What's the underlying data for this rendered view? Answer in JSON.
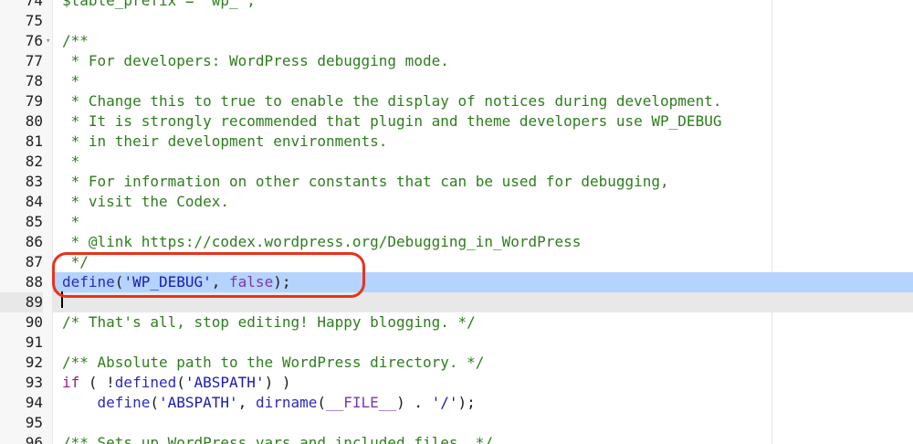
{
  "editor": {
    "lines": [
      {
        "num": "74",
        "fold": "",
        "hl": "",
        "tokens": [
          {
            "c": "comment",
            "t": "$table_prefix = 'wp_';"
          }
        ]
      },
      {
        "num": "75",
        "fold": "",
        "hl": "",
        "tokens": []
      },
      {
        "num": "76",
        "fold": "▾",
        "hl": "",
        "tokens": [
          {
            "c": "comment",
            "t": "/**"
          }
        ]
      },
      {
        "num": "77",
        "fold": "",
        "hl": "",
        "tokens": [
          {
            "c": "comment",
            "t": " * For developers: WordPress debugging mode."
          }
        ]
      },
      {
        "num": "78",
        "fold": "",
        "hl": "",
        "tokens": [
          {
            "c": "comment",
            "t": " *"
          }
        ]
      },
      {
        "num": "79",
        "fold": "",
        "hl": "",
        "tokens": [
          {
            "c": "comment",
            "t": " * Change this to true to enable the display of notices during development."
          }
        ]
      },
      {
        "num": "80",
        "fold": "",
        "hl": "",
        "tokens": [
          {
            "c": "comment",
            "t": " * It is strongly recommended that plugin and theme developers use WP_DEBUG"
          }
        ]
      },
      {
        "num": "81",
        "fold": "",
        "hl": "",
        "tokens": [
          {
            "c": "comment",
            "t": " * in their development environments."
          }
        ]
      },
      {
        "num": "82",
        "fold": "",
        "hl": "",
        "tokens": [
          {
            "c": "comment",
            "t": " *"
          }
        ]
      },
      {
        "num": "83",
        "fold": "",
        "hl": "",
        "tokens": [
          {
            "c": "comment",
            "t": " * For information on other constants that can be used for debugging,"
          }
        ]
      },
      {
        "num": "84",
        "fold": "",
        "hl": "",
        "tokens": [
          {
            "c": "comment",
            "t": " * visit the Codex."
          }
        ]
      },
      {
        "num": "85",
        "fold": "",
        "hl": "",
        "tokens": [
          {
            "c": "comment",
            "t": " *"
          }
        ]
      },
      {
        "num": "86",
        "fold": "",
        "hl": "",
        "tokens": [
          {
            "c": "comment",
            "t": " * @link https://codex.wordpress.org/Debugging_in_WordPress"
          }
        ]
      },
      {
        "num": "87",
        "fold": "",
        "hl": "",
        "tokens": [
          {
            "c": "comment",
            "t": " */"
          }
        ]
      },
      {
        "num": "88",
        "fold": "",
        "hl": "sel",
        "tokens": [
          {
            "c": "func",
            "t": "define"
          },
          {
            "c": "plain",
            "t": "("
          },
          {
            "c": "str",
            "t": "'WP_DEBUG'"
          },
          {
            "c": "plain",
            "t": ", "
          },
          {
            "c": "const",
            "t": "false"
          },
          {
            "c": "plain",
            "t": ");"
          }
        ]
      },
      {
        "num": "89",
        "fold": "",
        "hl": "cur",
        "tokens": []
      },
      {
        "num": "90",
        "fold": "",
        "hl": "",
        "tokens": [
          {
            "c": "comment",
            "t": "/* That's all, stop editing! Happy blogging. */"
          }
        ]
      },
      {
        "num": "91",
        "fold": "",
        "hl": "",
        "tokens": []
      },
      {
        "num": "92",
        "fold": "",
        "hl": "",
        "tokens": [
          {
            "c": "comment",
            "t": "/** Absolute path to the WordPress directory. */"
          }
        ]
      },
      {
        "num": "93",
        "fold": "",
        "hl": "",
        "tokens": [
          {
            "c": "key",
            "t": "if"
          },
          {
            "c": "plain",
            "t": " ( !"
          },
          {
            "c": "func",
            "t": "defined"
          },
          {
            "c": "plain",
            "t": "("
          },
          {
            "c": "str",
            "t": "'ABSPATH'"
          },
          {
            "c": "plain",
            "t": ") )"
          }
        ]
      },
      {
        "num": "94",
        "fold": "",
        "hl": "",
        "tokens": [
          {
            "c": "plain",
            "t": "    "
          },
          {
            "c": "func",
            "t": "define"
          },
          {
            "c": "plain",
            "t": "("
          },
          {
            "c": "str",
            "t": "'ABSPATH'"
          },
          {
            "c": "plain",
            "t": ", "
          },
          {
            "c": "func",
            "t": "dirname"
          },
          {
            "c": "plain",
            "t": "("
          },
          {
            "c": "const",
            "t": "__FILE__"
          },
          {
            "c": "plain",
            "t": ") . "
          },
          {
            "c": "str",
            "t": "'/'"
          },
          {
            "c": "plain",
            "t": ");"
          }
        ]
      },
      {
        "num": "95",
        "fold": "",
        "hl": "",
        "tokens": []
      },
      {
        "num": "96",
        "fold": "",
        "hl": "",
        "tokens": [
          {
            "c": "comment",
            "t": "/** Sets up WordPress vars and included files. */"
          }
        ]
      }
    ]
  },
  "colors": {
    "annotation": "#e8331c",
    "selection": "#b4d3fd",
    "comment": "#2e7d1e"
  }
}
